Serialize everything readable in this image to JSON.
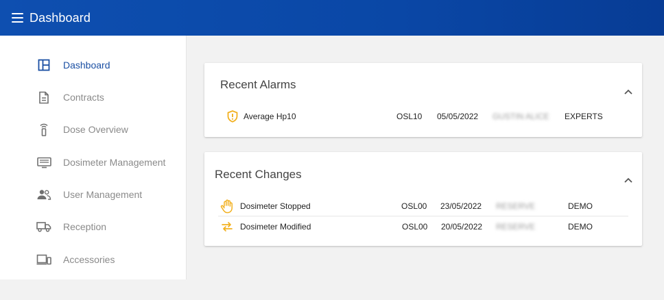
{
  "header": {
    "title": "Dashboard",
    "menu_icon": "menu-icon"
  },
  "sidebar": {
    "items": [
      {
        "label": "Dashboard",
        "icon": "dashboard-icon",
        "active": true
      },
      {
        "label": "Contracts",
        "icon": "document-icon"
      },
      {
        "label": "Dose Overview",
        "icon": "dosimeter-icon"
      },
      {
        "label": "Dosimeter Management",
        "icon": "monitor-icon"
      },
      {
        "label": "User Management",
        "icon": "users-icon"
      },
      {
        "label": "Reception",
        "icon": "truck-icon"
      },
      {
        "label": "Accessories",
        "icon": "devices-icon"
      }
    ]
  },
  "alarms": {
    "title": "Recent Alarms",
    "rows": [
      {
        "icon": "shield-alert-icon",
        "name": "Average Hp10",
        "code": "OSL10",
        "date": "05/05/2022",
        "person": "GUSTIN ALICE",
        "group": "EXPERTS"
      }
    ]
  },
  "changes": {
    "title": "Recent Changes",
    "rows": [
      {
        "icon": "hand-stop-icon",
        "name": "Dosimeter Stopped",
        "code": "OSL00",
        "date": "23/05/2022",
        "person": "RESERVE",
        "group": "DEMO"
      },
      {
        "icon": "swap-arrows-icon",
        "name": "Dosimeter Modified",
        "code": "OSL00",
        "date": "20/05/2022",
        "person": "RESERVE",
        "group": "DEMO"
      }
    ]
  },
  "colors": {
    "primary": "#0e4fb0",
    "active_nav": "#1a4fa3",
    "accent": "#f2b01e"
  }
}
